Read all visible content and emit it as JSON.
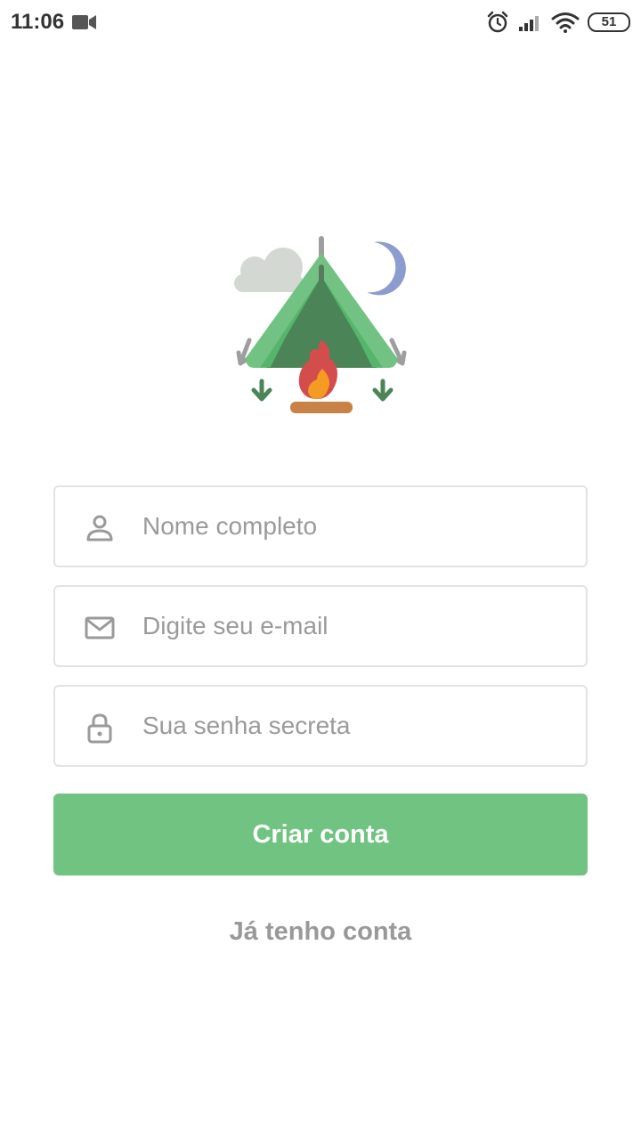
{
  "status_bar": {
    "time": "11:06",
    "battery": "51",
    "icons": [
      "video-camera-icon",
      "alarm-icon",
      "signal-icon",
      "wifi-icon",
      "battery-icon"
    ]
  },
  "illustration": {
    "icon": "camping-tent-icon"
  },
  "form": {
    "name_placeholder": "Nome completo",
    "email_placeholder": "Digite seu e-mail",
    "password_placeholder": "Sua senha secreta",
    "name_icon": "user-icon",
    "email_icon": "mail-icon",
    "password_icon": "lock-icon"
  },
  "actions": {
    "submit_label": "Criar conta",
    "login_label": "Já tenho conta"
  },
  "colors": {
    "accent": "#70c380",
    "tent_dark": "#4a8457",
    "fire": "#d44d4d",
    "moon": "#8c9ccf"
  }
}
